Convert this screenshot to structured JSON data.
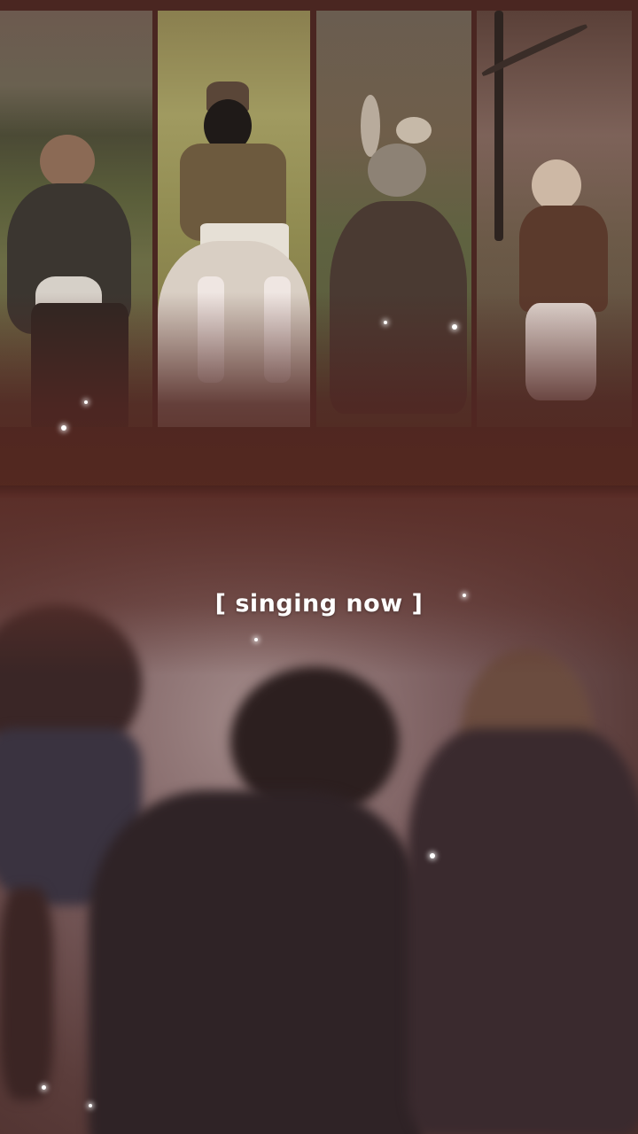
{
  "caption": "[ singing now ]",
  "colors": {
    "background": "#5a2e28",
    "caption_text": "#ffffff"
  },
  "photos": [
    {
      "name": "photo-1"
    },
    {
      "name": "photo-2"
    },
    {
      "name": "photo-3"
    },
    {
      "name": "photo-4"
    }
  ]
}
